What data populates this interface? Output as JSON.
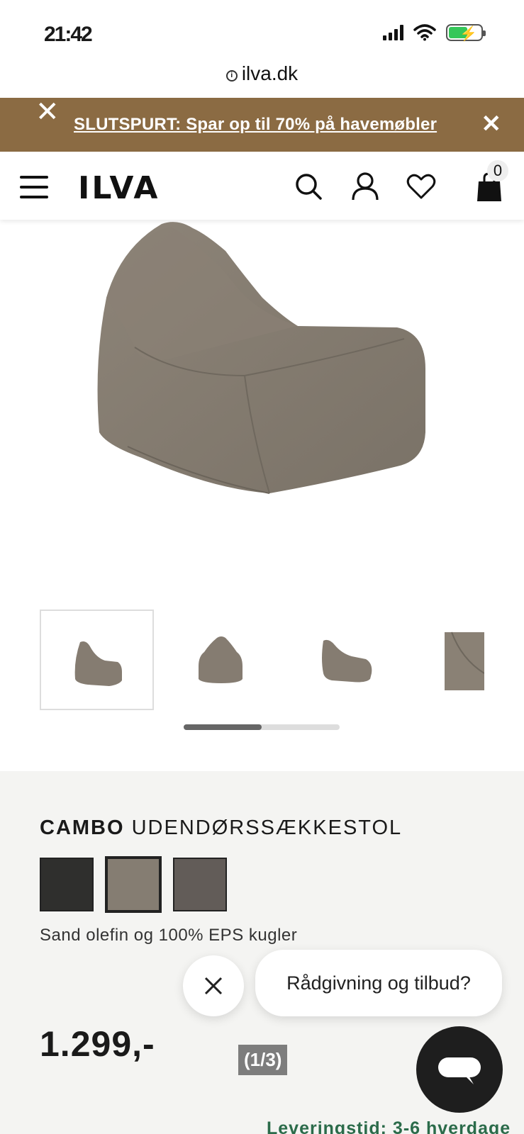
{
  "status_bar": {
    "time": "21:42"
  },
  "browser": {
    "url": "ilva.dk"
  },
  "promo": {
    "text": "SLUTSPURT: Spar op til 70% på havemøbler"
  },
  "header": {
    "logo": "ILVA",
    "cart_count": "0"
  },
  "product": {
    "brand": "CAMBO",
    "name": "UDENDØRSSÆKKESTOL",
    "material": "Sand olefin og 100% EPS kugler",
    "price": "1.299,-",
    "image_counter": "(1/3)",
    "delivery": "Leveringstid: 3-6 hverdage",
    "swatch_colors": [
      "#2f2f2d",
      "#857d72",
      "#625c58"
    ],
    "selected_swatch": 1
  },
  "gallery": {
    "thumbnail_count": 4,
    "selected_index": 0,
    "scroll_fraction": 0.5
  },
  "chat": {
    "prompt": "Rådgivning og tilbud?"
  },
  "colors": {
    "promo_bg": "#8b6b43",
    "info_bg": "#f4f4f2",
    "chair": "#857c71"
  }
}
